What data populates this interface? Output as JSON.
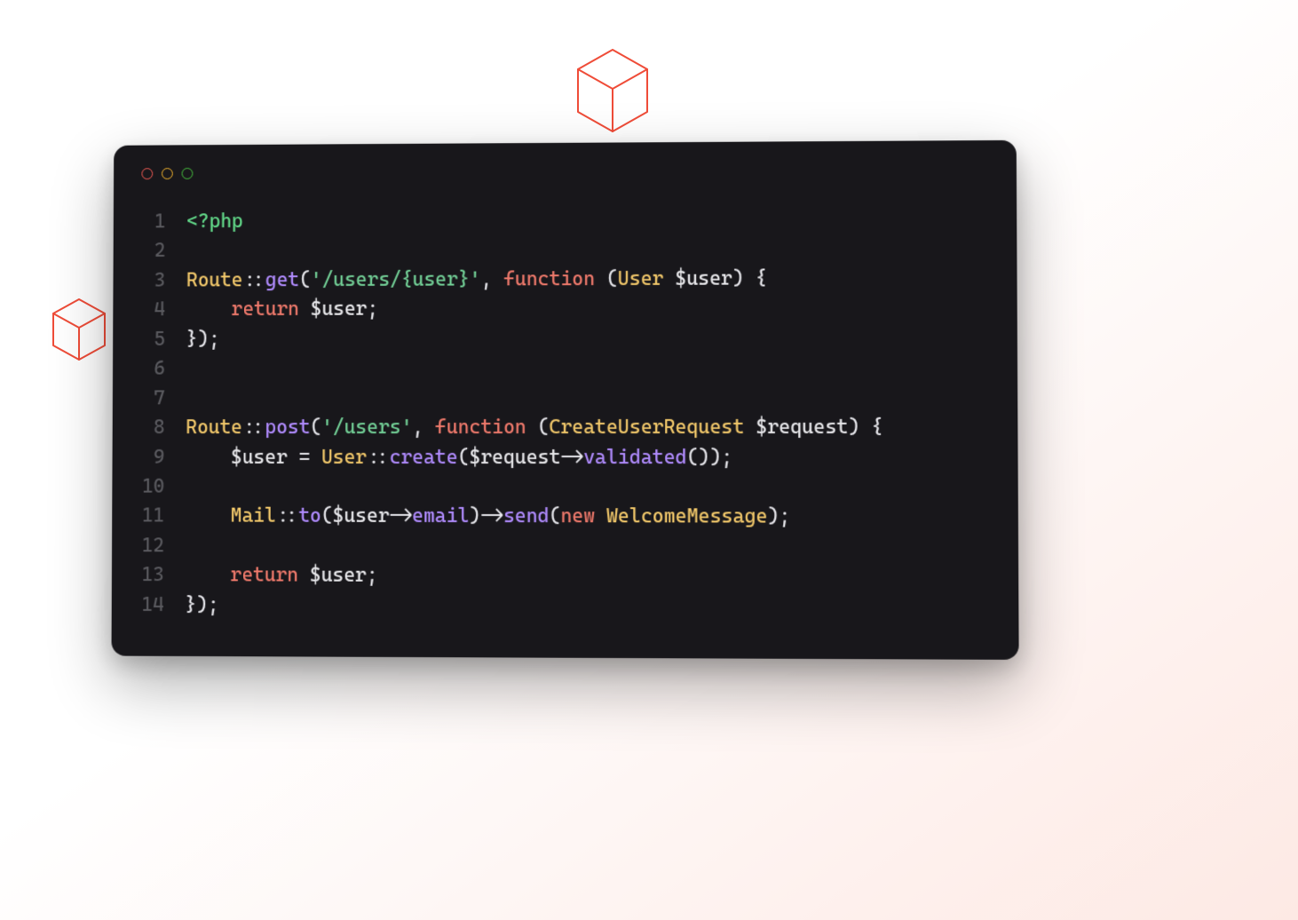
{
  "line_numbers": [
    "1",
    "2",
    "3",
    "4",
    "5",
    "6",
    "7",
    "8",
    "9",
    "10",
    "11",
    "12",
    "13",
    "14"
  ],
  "code": {
    "l1": {
      "tag": "<?php"
    },
    "l3": {
      "route": "Route",
      "dcolon": "::",
      "get": "get",
      "op": "(",
      "str": "'/users/{user}'",
      "comma": ", ",
      "fn": "function ",
      "op2": "(",
      "type": "User ",
      "var": "$user",
      "cp": ") {"
    },
    "l4": {
      "indent": "    ",
      "ret": "return ",
      "var": "$user",
      "semi": ";"
    },
    "l5": {
      "close": "});"
    },
    "l8": {
      "route": "Route",
      "dcolon": "::",
      "post": "post",
      "op": "(",
      "str": "'/users'",
      "comma": ", ",
      "fn": "function ",
      "op2": "(",
      "type": "CreateUserRequest ",
      "var": "$request",
      "cp": ") {"
    },
    "l9": {
      "indent": "    ",
      "var": "$user",
      "eq": " = ",
      "cls": "User",
      "dcolon": "::",
      "create": "create",
      "op": "(",
      "var2": "$request",
      "arrow": "->",
      "validated": "validated",
      "cp": "());"
    },
    "l11": {
      "indent": "    ",
      "mail": "Mail",
      "dcolon": "::",
      "to": "to",
      "op": "(",
      "var": "$user",
      "arrow": "->",
      "email": "email",
      "cp": ")",
      "arrow2": "->",
      "send": "send",
      "op2": "(",
      "new": "new ",
      "wm": "WelcomeMessage",
      "cp2": ");"
    },
    "l13": {
      "indent": "    ",
      "ret": "return ",
      "var": "$user",
      "semi": ";"
    },
    "l14": {
      "close": "});"
    }
  }
}
